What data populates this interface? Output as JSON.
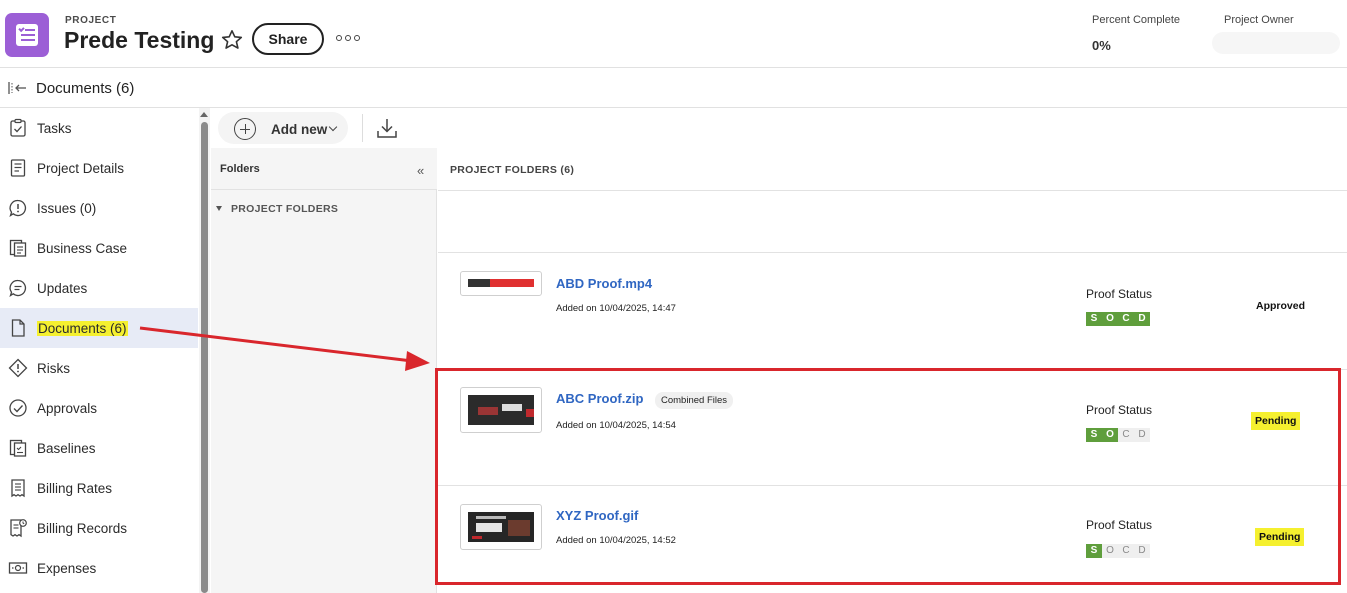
{
  "header": {
    "section_label": "PROJECT",
    "title": "Prede Testing",
    "share_label": "Share",
    "percent_complete_label": "Percent Complete",
    "percent_complete_value": "0%",
    "project_owner_label": "Project Owner",
    "icons": {
      "star": "star-icon",
      "more": "more-icon",
      "project": "project-icon"
    },
    "colors": {
      "project_icon_bg": "#9c5fd6"
    }
  },
  "docbar": {
    "title": "Documents (6)"
  },
  "sidebar": {
    "items": [
      {
        "label": "Tasks",
        "icon": "tasks-icon"
      },
      {
        "label": "Project Details",
        "icon": "details-icon"
      },
      {
        "label": "Issues (0)",
        "icon": "issues-icon"
      },
      {
        "label": "Business Case",
        "icon": "business-case-icon"
      },
      {
        "label": "Updates",
        "icon": "updates-icon"
      },
      {
        "label": "Documents (6)",
        "icon": "document-icon",
        "active": true,
        "highlighted": true
      },
      {
        "label": "Risks",
        "icon": "risks-icon"
      },
      {
        "label": "Approvals",
        "icon": "approvals-icon"
      },
      {
        "label": "Baselines",
        "icon": "baselines-icon"
      },
      {
        "label": "Billing Rates",
        "icon": "billing-rates-icon"
      },
      {
        "label": "Billing Records",
        "icon": "billing-records-icon"
      },
      {
        "label": "Expenses",
        "icon": "expenses-icon"
      }
    ]
  },
  "toolbar": {
    "add_new_label": "Add new"
  },
  "folders": {
    "title": "Folders",
    "collapse_glyph": "«",
    "tree_root": "PROJECT FOLDERS"
  },
  "main": {
    "title": "PROJECT FOLDERS (6)",
    "documents": [
      {
        "name": "ABD Proof.mp4",
        "added": "Added on 10/04/2025, 14:47",
        "badge": "",
        "proof_status_label": "Proof Status",
        "soc": [
          "S",
          "O",
          "C",
          "D"
        ],
        "soc_on": [
          true,
          true,
          true,
          true
        ],
        "status": "Approved"
      },
      {
        "name": "ABC Proof.zip",
        "added": "Added on 10/04/2025, 14:54",
        "badge": "Combined Files",
        "proof_status_label": "Proof Status",
        "soc": [
          "S",
          "O",
          "C",
          "D"
        ],
        "soc_on": [
          true,
          true,
          false,
          false
        ],
        "status": "Pending"
      },
      {
        "name": "XYZ Proof.gif",
        "added": "Added on 10/04/2025, 14:52",
        "badge": "",
        "proof_status_label": "Proof Status",
        "soc": [
          "S",
          "O",
          "C",
          "D"
        ],
        "soc_on": [
          true,
          false,
          false,
          false
        ],
        "status": "Pending"
      }
    ]
  },
  "colors": {
    "accent_link": "#2f66c2",
    "soc_on": "#5f9e3c",
    "highlight": "#f5f02f",
    "annotation_red": "#d9262c"
  }
}
